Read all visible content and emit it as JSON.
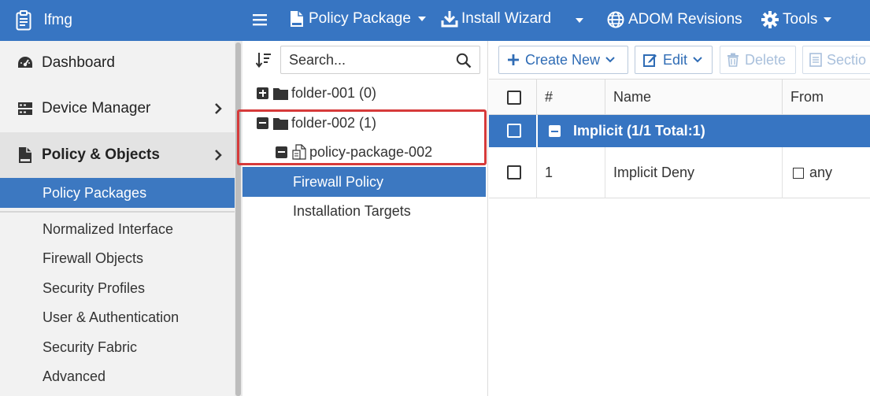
{
  "topbar": {
    "app_name": "lfmg",
    "menu": {
      "policy_package": "Policy Package",
      "install_wizard": "Install Wizard",
      "adom_revisions": "ADOM Revisions",
      "tools": "Tools"
    }
  },
  "sidebar": {
    "items": [
      {
        "label": "Dashboard",
        "icon": "dashboard-icon"
      },
      {
        "label": "Device Manager",
        "icon": "device-manager-icon"
      },
      {
        "label": "Policy & Objects",
        "icon": "policy-objects-icon"
      }
    ],
    "sub_items": [
      {
        "label": "Policy Packages",
        "selected": true
      },
      {
        "label": "Normalized Interface"
      },
      {
        "label": "Firewall Objects"
      },
      {
        "label": "Security Profiles"
      },
      {
        "label": "User & Authentication"
      },
      {
        "label": "Security Fabric"
      },
      {
        "label": "Advanced"
      }
    ]
  },
  "tree": {
    "search_placeholder": "Search...",
    "nodes": [
      {
        "label": "folder-001 (0)",
        "expanded": false
      },
      {
        "label": "folder-002 (1)",
        "expanded": true
      },
      {
        "label": "policy-package-002",
        "expanded": true
      },
      {
        "label": "Firewall Policy",
        "selected": true
      },
      {
        "label": "Installation Targets"
      }
    ]
  },
  "toolbar": {
    "create_new": "Create New",
    "edit": "Edit",
    "delete": "Delete",
    "section": "Sectio"
  },
  "grid": {
    "columns": [
      "#",
      "Name",
      "From"
    ],
    "group": {
      "label": "Implicit (1/1 Total:1)"
    },
    "rows": [
      {
        "num": "1",
        "name": "Implicit Deny",
        "from": "any"
      }
    ]
  },
  "colors": {
    "topbar": "#3775c2",
    "selection": "#3c78c1",
    "highlight_border": "#d63a3a"
  }
}
